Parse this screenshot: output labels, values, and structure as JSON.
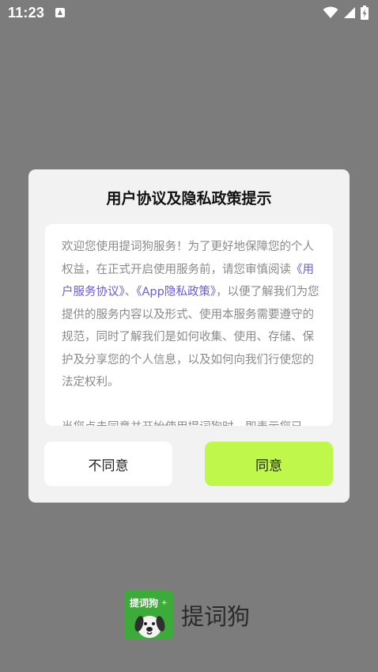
{
  "status_bar": {
    "time": "11:23",
    "icons": [
      "app-notification-icon",
      "wifi-icon",
      "signal-icon",
      "battery-charging-icon"
    ]
  },
  "dialog": {
    "title": "用户协议及隐私政策提示",
    "body": {
      "p1_before": "欢迎您使用提词狗服务！为了更好地保障您的个人权益，在正式开启使用服务前，请您审慎阅读",
      "link_user_agreement": "《用户服务协议》",
      "separator": "、",
      "link_privacy_policy": "《App隐私政策》",
      "p1_after": "，以便了解我们为您提供的服务内容以及形式、使用本服务需要遵守的规范，同时了解我们是如何收集、使用、存储、保护及分享您的个人信息，以及如何向我们行使您的法定权利。",
      "p2": "当您点击同意并开始使用提词狗时，即表示您已"
    },
    "disagree_label": "不同意",
    "agree_label": "同意"
  },
  "brand": {
    "name": "提词狗",
    "logo_text": "提词狗"
  },
  "colors": {
    "overlay": "#7c7c7c",
    "dialog_bg": "#f2f2f2",
    "agree_button": "#bff74a",
    "link": "#6c5bd6",
    "logo_bg": "#3cab3a"
  }
}
